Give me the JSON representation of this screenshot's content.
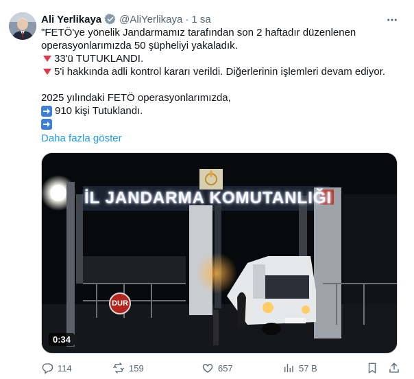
{
  "author": {
    "name": "Ali Yerlikaya",
    "handle": "@AliYerlikaya",
    "separator": "·",
    "time": "1 sa"
  },
  "tweet": {
    "line1": "\"FETÖ'ye yönelik Jandarmamız tarafından son 2 haftadır düzenlenen",
    "line2": "operasyonlarımızda 50 şüpheliyi yakaladık.",
    "bullet1": "33'ü TUTUKLANDI.",
    "bullet2": "5'i hakkında adli kontrol kararı verildi. Diğerlerinin işlemleri devam ediyor.",
    "line3": "2025 yılındaki FETÖ operasyonlarımızda,",
    "arrow1": "910 kişi Tutuklandı.",
    "arrow2": "",
    "show_more": "Daha fazla göster"
  },
  "media": {
    "sign_text": "İL JANDARMA KOMUTANLIĞI",
    "stop_sign": "DUR",
    "duration": "0:34"
  },
  "actions": {
    "replies": "114",
    "reposts": "159",
    "likes": "657",
    "views": "57 B"
  },
  "colors": {
    "link": "#1d9bf0",
    "verified": "#829aab",
    "triangle": "#e0384a",
    "arrow_box": "#3d7fd6"
  }
}
